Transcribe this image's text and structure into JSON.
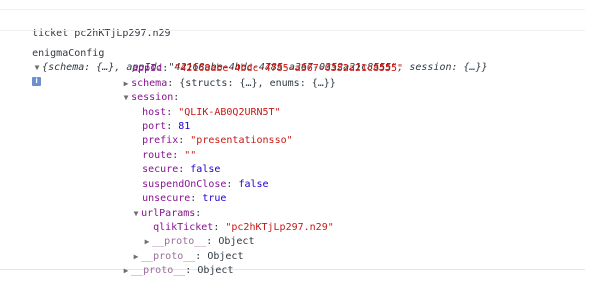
{
  "console": {
    "ticket_line": "ticket pc2hKTjLp297.n29",
    "root_label": "enigmaConfig",
    "root_summary": "{schema: {…}, appId: \"42168abe-4bdc-4785-a367-0352a21c8555\", session: {…}}",
    "info_badge": "i",
    "appId_key": "appId",
    "appId_value": "\"42168abe-4bdc-4785-a367-0352a21c8555\"",
    "schema_key": "schema",
    "schema_value": "{structs: {…}, enums: {…}}",
    "session_key": "session",
    "host_key": "host",
    "host_value": "\"QLIK-AB0Q2URN5T\"",
    "port_key": "port",
    "port_value": "81",
    "prefix_key": "prefix",
    "prefix_value": "\"presentationsso\"",
    "route_key": "route",
    "route_value": "\"\"",
    "secure_key": "secure",
    "secure_value": "false",
    "suspend_key": "suspendOnClose",
    "suspend_value": "false",
    "unsecure_key": "unsecure",
    "unsecure_value": "true",
    "urlParams_key": "urlParams",
    "qlikTicket_key": "qlikTicket",
    "qlikTicket_value": "\"pc2hKTjLp297.n29\"",
    "proto_key": "__proto__",
    "proto_value": "Object",
    "colon": ":"
  }
}
